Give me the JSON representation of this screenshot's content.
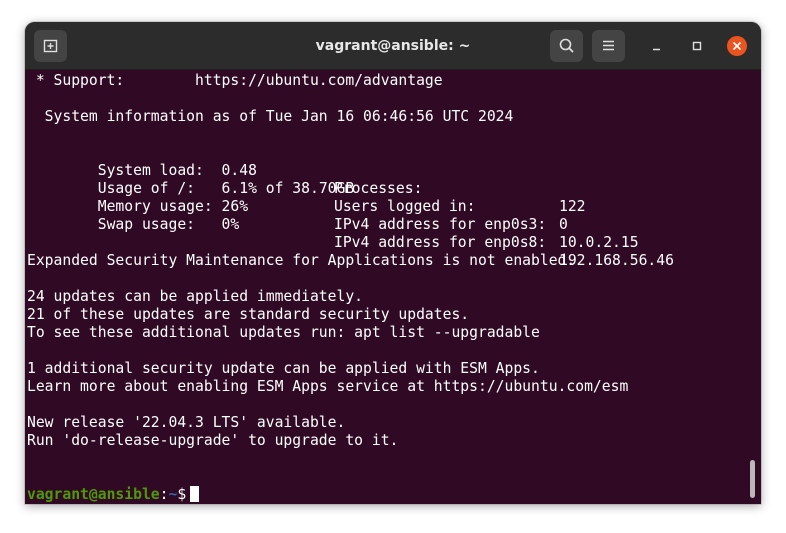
{
  "window": {
    "title": "vagrant@ansible: ~"
  },
  "colors": {
    "terminal_bg": "#300a24",
    "titlebar_bg": "#2c2c2c",
    "close_button": "#e95420",
    "prompt_user": "#4e9a06",
    "prompt_path": "#3465a4"
  },
  "icons": {
    "new_tab": "new-tab-icon",
    "search": "search-icon",
    "menu": "hamburger-menu-icon",
    "minimize": "minimize-icon",
    "maximize": "maximize-icon",
    "close": "close-icon"
  },
  "terminal": {
    "support_line": " * Support:        https://ubuntu.com/advantage",
    "sysinfo_line": "  System information as of Tue Jan 16 06:46:56 UTC 2024",
    "stats": [
      {
        "label": "  System load:  0.48",
        "label2": "Processes:",
        "value2": "122"
      },
      {
        "label": "  Usage of /:   6.1% of 38.70GB",
        "label2": "Users logged in:",
        "value2": "0"
      },
      {
        "label": "  Memory usage: 26%",
        "label2": "IPv4 address for enp0s3:",
        "value2": "10.0.2.15"
      },
      {
        "label": "  Swap usage:   0%",
        "label2": "IPv4 address for enp0s8:",
        "value2": "192.168.56.46"
      }
    ],
    "esm_line": "Expanded Security Maintenance for Applications is not enabled.",
    "updates_line_1": "24 updates can be applied immediately.",
    "updates_line_2": "21 of these updates are standard security updates.",
    "updates_line_3": "To see these additional updates run: apt list --upgradable",
    "esm_apps_line_1": "1 additional security update can be applied with ESM Apps.",
    "esm_apps_line_2": "Learn more about enabling ESM Apps service at https://ubuntu.com/esm",
    "release_line_1": "New release '22.04.3 LTS' available.",
    "release_line_2": "Run 'do-release-upgrade' to upgrade to it.",
    "prompt": {
      "user_host": "vagrant@ansible",
      "colon": ":",
      "path": "~",
      "symbol": "$"
    }
  }
}
